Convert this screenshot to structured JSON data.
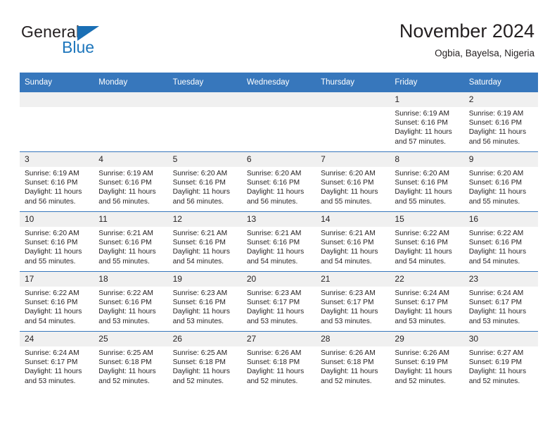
{
  "logo": {
    "word_one": "General",
    "word_two": "Blue",
    "triangle_icon": "triangle-icon",
    "brand_blue": "#1d76bc"
  },
  "header": {
    "title": "November 2024",
    "location": "Ogbia, Bayelsa, Nigeria"
  },
  "colors": {
    "header_blue": "#3777bc",
    "daynum_band": "#f0f0f0",
    "text": "#231f20"
  },
  "weekdays": [
    "Sunday",
    "Monday",
    "Tuesday",
    "Wednesday",
    "Thursday",
    "Friday",
    "Saturday"
  ],
  "labels": {
    "sunrise": "Sunrise:",
    "sunset": "Sunset:",
    "daylight": "Daylight:"
  },
  "weeks": [
    [
      {
        "day": "",
        "empty": true
      },
      {
        "day": "",
        "empty": true
      },
      {
        "day": "",
        "empty": true
      },
      {
        "day": "",
        "empty": true
      },
      {
        "day": "",
        "empty": true
      },
      {
        "day": "1",
        "sunrise": "Sunrise: 6:19 AM",
        "sunset": "Sunset: 6:16 PM",
        "daylight_1": "Daylight: 11 hours",
        "daylight_2": "and 57 minutes."
      },
      {
        "day": "2",
        "sunrise": "Sunrise: 6:19 AM",
        "sunset": "Sunset: 6:16 PM",
        "daylight_1": "Daylight: 11 hours",
        "daylight_2": "and 56 minutes."
      }
    ],
    [
      {
        "day": "3",
        "sunrise": "Sunrise: 6:19 AM",
        "sunset": "Sunset: 6:16 PM",
        "daylight_1": "Daylight: 11 hours",
        "daylight_2": "and 56 minutes."
      },
      {
        "day": "4",
        "sunrise": "Sunrise: 6:19 AM",
        "sunset": "Sunset: 6:16 PM",
        "daylight_1": "Daylight: 11 hours",
        "daylight_2": "and 56 minutes."
      },
      {
        "day": "5",
        "sunrise": "Sunrise: 6:20 AM",
        "sunset": "Sunset: 6:16 PM",
        "daylight_1": "Daylight: 11 hours",
        "daylight_2": "and 56 minutes."
      },
      {
        "day": "6",
        "sunrise": "Sunrise: 6:20 AM",
        "sunset": "Sunset: 6:16 PM",
        "daylight_1": "Daylight: 11 hours",
        "daylight_2": "and 56 minutes."
      },
      {
        "day": "7",
        "sunrise": "Sunrise: 6:20 AM",
        "sunset": "Sunset: 6:16 PM",
        "daylight_1": "Daylight: 11 hours",
        "daylight_2": "and 55 minutes."
      },
      {
        "day": "8",
        "sunrise": "Sunrise: 6:20 AM",
        "sunset": "Sunset: 6:16 PM",
        "daylight_1": "Daylight: 11 hours",
        "daylight_2": "and 55 minutes."
      },
      {
        "day": "9",
        "sunrise": "Sunrise: 6:20 AM",
        "sunset": "Sunset: 6:16 PM",
        "daylight_1": "Daylight: 11 hours",
        "daylight_2": "and 55 minutes."
      }
    ],
    [
      {
        "day": "10",
        "sunrise": "Sunrise: 6:20 AM",
        "sunset": "Sunset: 6:16 PM",
        "daylight_1": "Daylight: 11 hours",
        "daylight_2": "and 55 minutes."
      },
      {
        "day": "11",
        "sunrise": "Sunrise: 6:21 AM",
        "sunset": "Sunset: 6:16 PM",
        "daylight_1": "Daylight: 11 hours",
        "daylight_2": "and 55 minutes."
      },
      {
        "day": "12",
        "sunrise": "Sunrise: 6:21 AM",
        "sunset": "Sunset: 6:16 PM",
        "daylight_1": "Daylight: 11 hours",
        "daylight_2": "and 54 minutes."
      },
      {
        "day": "13",
        "sunrise": "Sunrise: 6:21 AM",
        "sunset": "Sunset: 6:16 PM",
        "daylight_1": "Daylight: 11 hours",
        "daylight_2": "and 54 minutes."
      },
      {
        "day": "14",
        "sunrise": "Sunrise: 6:21 AM",
        "sunset": "Sunset: 6:16 PM",
        "daylight_1": "Daylight: 11 hours",
        "daylight_2": "and 54 minutes."
      },
      {
        "day": "15",
        "sunrise": "Sunrise: 6:22 AM",
        "sunset": "Sunset: 6:16 PM",
        "daylight_1": "Daylight: 11 hours",
        "daylight_2": "and 54 minutes."
      },
      {
        "day": "16",
        "sunrise": "Sunrise: 6:22 AM",
        "sunset": "Sunset: 6:16 PM",
        "daylight_1": "Daylight: 11 hours",
        "daylight_2": "and 54 minutes."
      }
    ],
    [
      {
        "day": "17",
        "sunrise": "Sunrise: 6:22 AM",
        "sunset": "Sunset: 6:16 PM",
        "daylight_1": "Daylight: 11 hours",
        "daylight_2": "and 54 minutes."
      },
      {
        "day": "18",
        "sunrise": "Sunrise: 6:22 AM",
        "sunset": "Sunset: 6:16 PM",
        "daylight_1": "Daylight: 11 hours",
        "daylight_2": "and 53 minutes."
      },
      {
        "day": "19",
        "sunrise": "Sunrise: 6:23 AM",
        "sunset": "Sunset: 6:16 PM",
        "daylight_1": "Daylight: 11 hours",
        "daylight_2": "and 53 minutes."
      },
      {
        "day": "20",
        "sunrise": "Sunrise: 6:23 AM",
        "sunset": "Sunset: 6:17 PM",
        "daylight_1": "Daylight: 11 hours",
        "daylight_2": "and 53 minutes."
      },
      {
        "day": "21",
        "sunrise": "Sunrise: 6:23 AM",
        "sunset": "Sunset: 6:17 PM",
        "daylight_1": "Daylight: 11 hours",
        "daylight_2": "and 53 minutes."
      },
      {
        "day": "22",
        "sunrise": "Sunrise: 6:24 AM",
        "sunset": "Sunset: 6:17 PM",
        "daylight_1": "Daylight: 11 hours",
        "daylight_2": "and 53 minutes."
      },
      {
        "day": "23",
        "sunrise": "Sunrise: 6:24 AM",
        "sunset": "Sunset: 6:17 PM",
        "daylight_1": "Daylight: 11 hours",
        "daylight_2": "and 53 minutes."
      }
    ],
    [
      {
        "day": "24",
        "sunrise": "Sunrise: 6:24 AM",
        "sunset": "Sunset: 6:17 PM",
        "daylight_1": "Daylight: 11 hours",
        "daylight_2": "and 53 minutes."
      },
      {
        "day": "25",
        "sunrise": "Sunrise: 6:25 AM",
        "sunset": "Sunset: 6:18 PM",
        "daylight_1": "Daylight: 11 hours",
        "daylight_2": "and 52 minutes."
      },
      {
        "day": "26",
        "sunrise": "Sunrise: 6:25 AM",
        "sunset": "Sunset: 6:18 PM",
        "daylight_1": "Daylight: 11 hours",
        "daylight_2": "and 52 minutes."
      },
      {
        "day": "27",
        "sunrise": "Sunrise: 6:26 AM",
        "sunset": "Sunset: 6:18 PM",
        "daylight_1": "Daylight: 11 hours",
        "daylight_2": "and 52 minutes."
      },
      {
        "day": "28",
        "sunrise": "Sunrise: 6:26 AM",
        "sunset": "Sunset: 6:18 PM",
        "daylight_1": "Daylight: 11 hours",
        "daylight_2": "and 52 minutes."
      },
      {
        "day": "29",
        "sunrise": "Sunrise: 6:26 AM",
        "sunset": "Sunset: 6:19 PM",
        "daylight_1": "Daylight: 11 hours",
        "daylight_2": "and 52 minutes."
      },
      {
        "day": "30",
        "sunrise": "Sunrise: 6:27 AM",
        "sunset": "Sunset: 6:19 PM",
        "daylight_1": "Daylight: 11 hours",
        "daylight_2": "and 52 minutes."
      }
    ]
  ]
}
